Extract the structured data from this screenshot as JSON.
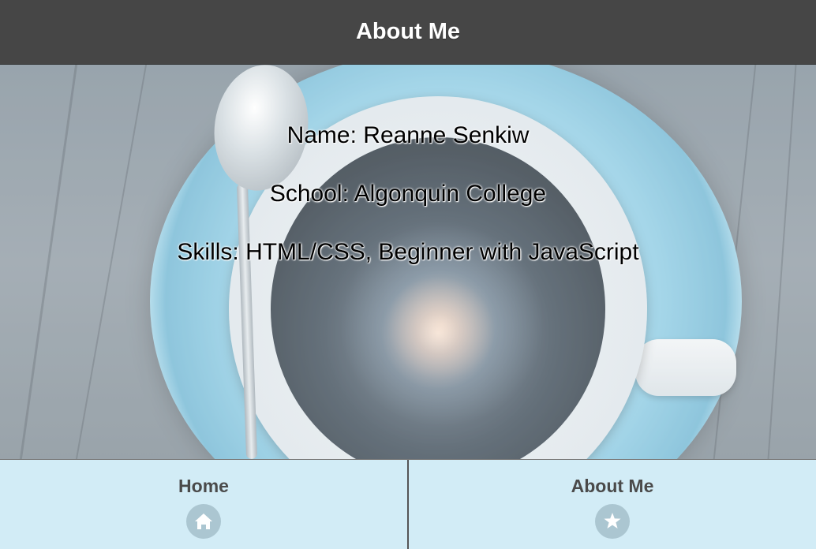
{
  "header": {
    "title": "About Me"
  },
  "profile": {
    "name_line": "Name: Reanne Senkiw",
    "school_line": "School: Algonquin College",
    "skills_line": "Skills: HTML/CSS, Beginner with JavaScript"
  },
  "tabbar": {
    "tabs": [
      {
        "label": "Home",
        "icon": "home-icon"
      },
      {
        "label": "About Me",
        "icon": "star-icon"
      }
    ]
  },
  "colors": {
    "header_bg": "#464646",
    "tabbar_bg": "#d2ecf6",
    "icon_circle": "#abc6d1",
    "tab_text": "#4a4a4a"
  }
}
